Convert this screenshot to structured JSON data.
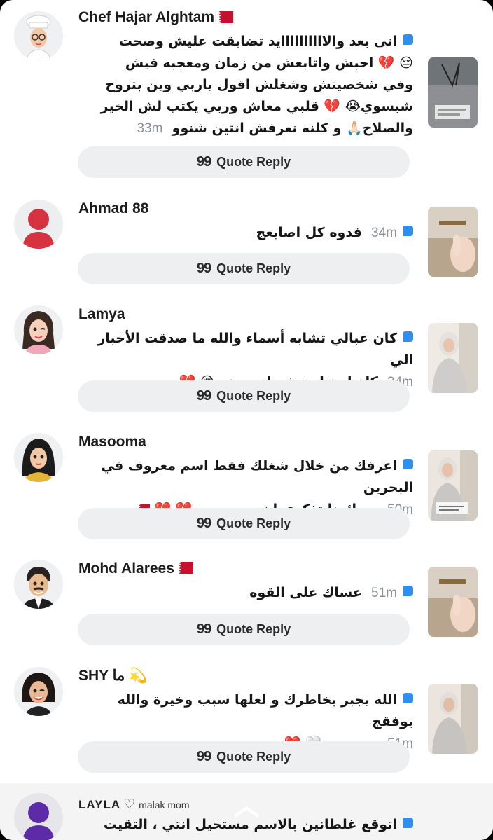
{
  "quote_reply_label": "Quote Reply",
  "quote_icon_glyph": "99",
  "comments": [
    {
      "name": "Chef Hajar Alghtam",
      "lines": [
        "انى بعد والاااااااااايد تضايقت عليش وصحت",
        "😔 💔 احبش واتابعش من زمان ومعجبه فيش",
        "وفي شخصيتش وشغلش  اقول ياربي وين بتروح",
        "شبسوي😭 💔 قلبي معاش وربي يكتب لش الخير"
      ],
      "last_line": "والصلاح🙏🏻 و كلنه نعرفش انتين شنوو",
      "time": "33m"
    },
    {
      "name": "Ahmad 88",
      "last_line": "فدوه كل اصابعج",
      "time": "34m"
    },
    {
      "name": "Lamya",
      "lines": [
        "كان عبالي تشابه أسماء والله ما صدقت الأخبار الي"
      ],
      "last_line": "كانوا ينزلون فيها صورتج 😢 💔",
      "time": "34m"
    },
    {
      "name": "Masooma",
      "lines": [
        "اعرفك من خلال شغلك فقط اسم معروف في البحرين"
      ],
      "last_line": ".. دائمنا تذكري ان معي ربي 💔 💔",
      "time": "50m"
    },
    {
      "name": "Mohd Alarees",
      "last_line": "عساك على القوه",
      "time": "51m"
    },
    {
      "name": "SHY ما 💫",
      "lines": [
        "الله يجبر بخاطرك و لعلها سبب وخيرة والله يوفقج"
      ],
      "last_line": "ويسعدج 🤍 ❤️",
      "time": "51m"
    }
  ],
  "bottom": {
    "name": "LAYLA",
    "heart": "♡",
    "sub": "malak mom",
    "text": "اتوقع غلطانين بالاسم مستحيل انتي ، التقيت فيش"
  },
  "colors": {
    "accent": "#2f8ff0",
    "button_bg": "#eeeff1",
    "flag_red": "#c8102e"
  }
}
